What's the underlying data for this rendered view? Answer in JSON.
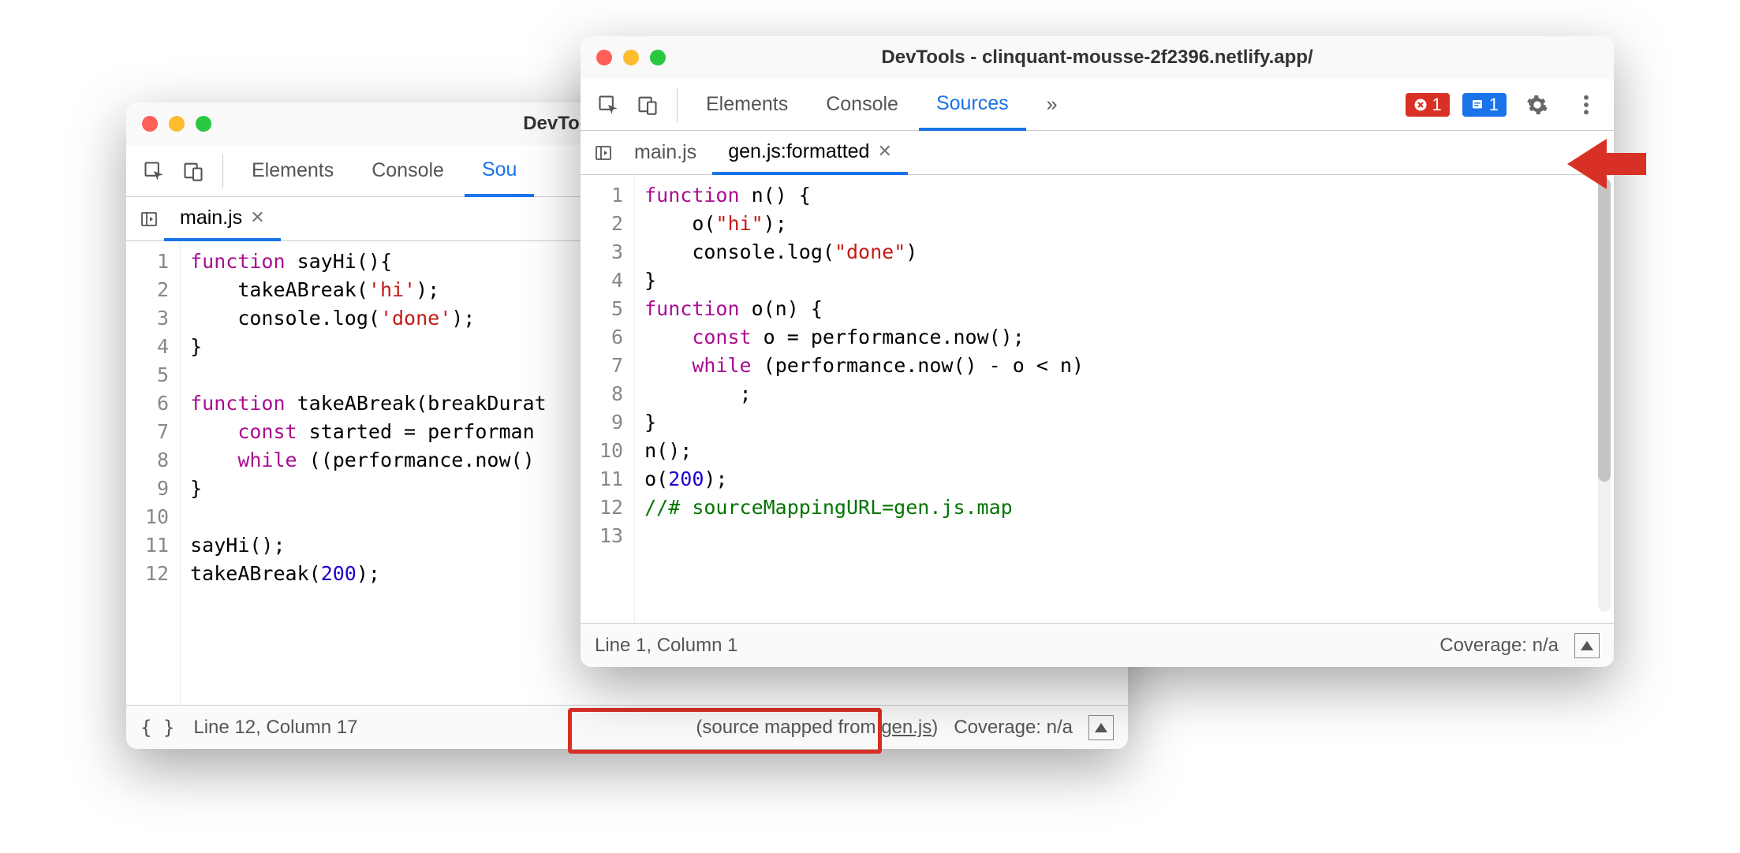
{
  "windowBack": {
    "title": "DevTools - clinquant-m",
    "panelTabs": {
      "elements": "Elements",
      "console": "Console",
      "sourcesCut": "Sou"
    },
    "fileTab": "main.js",
    "code": {
      "lines": [
        "1",
        "2",
        "3",
        "4",
        "5",
        "6",
        "7",
        "8",
        "9",
        "10",
        "11",
        "12"
      ],
      "raw": [
        {
          "t": [
            [
              "kw",
              "function"
            ],
            [
              "op",
              " sayHi()"
            ],
            [
              "op",
              "{"
            ]
          ]
        },
        {
          "t": [
            [
              "op",
              "    takeABreak("
            ],
            [
              "str",
              "'hi'"
            ],
            [
              "op",
              ");"
            ]
          ]
        },
        {
          "t": [
            [
              "op",
              "    console.log("
            ],
            [
              "str",
              "'done'"
            ],
            [
              "op",
              ");"
            ]
          ]
        },
        {
          "t": [
            [
              "op",
              "}"
            ]
          ]
        },
        {
          "t": [
            [
              "op",
              ""
            ]
          ]
        },
        {
          "t": [
            [
              "kw",
              "function"
            ],
            [
              "op",
              " takeABreak(breakDurat"
            ]
          ]
        },
        {
          "t": [
            [
              "op",
              "    "
            ],
            [
              "kw",
              "const"
            ],
            [
              "op",
              " started = performan"
            ]
          ]
        },
        {
          "t": [
            [
              "op",
              "    "
            ],
            [
              "kw",
              "while"
            ],
            [
              "op",
              " ((performance.now()"
            ]
          ]
        },
        {
          "t": [
            [
              "op",
              "}"
            ]
          ]
        },
        {
          "t": [
            [
              "op",
              ""
            ]
          ]
        },
        {
          "t": [
            [
              "op",
              "sayHi();"
            ]
          ]
        },
        {
          "t": [
            [
              "op",
              "takeABreak("
            ],
            [
              "num",
              "200"
            ],
            [
              "op",
              ");"
            ]
          ]
        }
      ]
    },
    "status": {
      "pretty": "{ }",
      "pos": "Line 12, Column 17",
      "mapped": "(source mapped from ",
      "mappedFile": "gen.js",
      "mappedClose": ")",
      "coverage": "Coverage: n/a"
    }
  },
  "windowFront": {
    "title": "DevTools - clinquant-mousse-2f2396.netlify.app/",
    "panelTabs": {
      "elements": "Elements",
      "console": "Console",
      "sources": "Sources",
      "more": "»"
    },
    "errBadge": "1",
    "infoBadge": "1",
    "fileTabs": {
      "first": "main.js",
      "second": "gen.js:formatted"
    },
    "code": {
      "lines": [
        "1",
        "2",
        "3",
        "4",
        "5",
        "6",
        "7",
        "8",
        "9",
        "10",
        "11",
        "12",
        "13"
      ],
      "raw": [
        {
          "t": [
            [
              "kw",
              "function"
            ],
            [
              "op",
              " n() {"
            ]
          ]
        },
        {
          "t": [
            [
              "op",
              "    o("
            ],
            [
              "str",
              "\"hi\""
            ],
            [
              "op",
              ");"
            ]
          ]
        },
        {
          "t": [
            [
              "op",
              "    console.log("
            ],
            [
              "str",
              "\"done\""
            ],
            [
              "op",
              ")"
            ]
          ]
        },
        {
          "t": [
            [
              "op",
              "}"
            ]
          ]
        },
        {
          "t": [
            [
              "kw",
              "function"
            ],
            [
              "op",
              " o(n) {"
            ]
          ]
        },
        {
          "t": [
            [
              "op",
              "    "
            ],
            [
              "kw",
              "const"
            ],
            [
              "op",
              " o = performance.now();"
            ]
          ]
        },
        {
          "t": [
            [
              "op",
              "    "
            ],
            [
              "kw",
              "while"
            ],
            [
              "op",
              " (performance.now() - o < n)"
            ]
          ]
        },
        {
          "t": [
            [
              "op",
              "        ;"
            ]
          ]
        },
        {
          "t": [
            [
              "op",
              "}"
            ]
          ]
        },
        {
          "t": [
            [
              "op",
              "n();"
            ]
          ]
        },
        {
          "t": [
            [
              "op",
              "o("
            ],
            [
              "num",
              "200"
            ],
            [
              "op",
              ");"
            ]
          ]
        },
        {
          "t": [
            [
              "cm",
              "//# sourceMappingURL=gen.js.map"
            ]
          ]
        },
        {
          "t": [
            [
              "op",
              ""
            ]
          ]
        }
      ]
    },
    "status": {
      "pos": "Line 1, Column 1",
      "coverage": "Coverage: n/a"
    }
  }
}
